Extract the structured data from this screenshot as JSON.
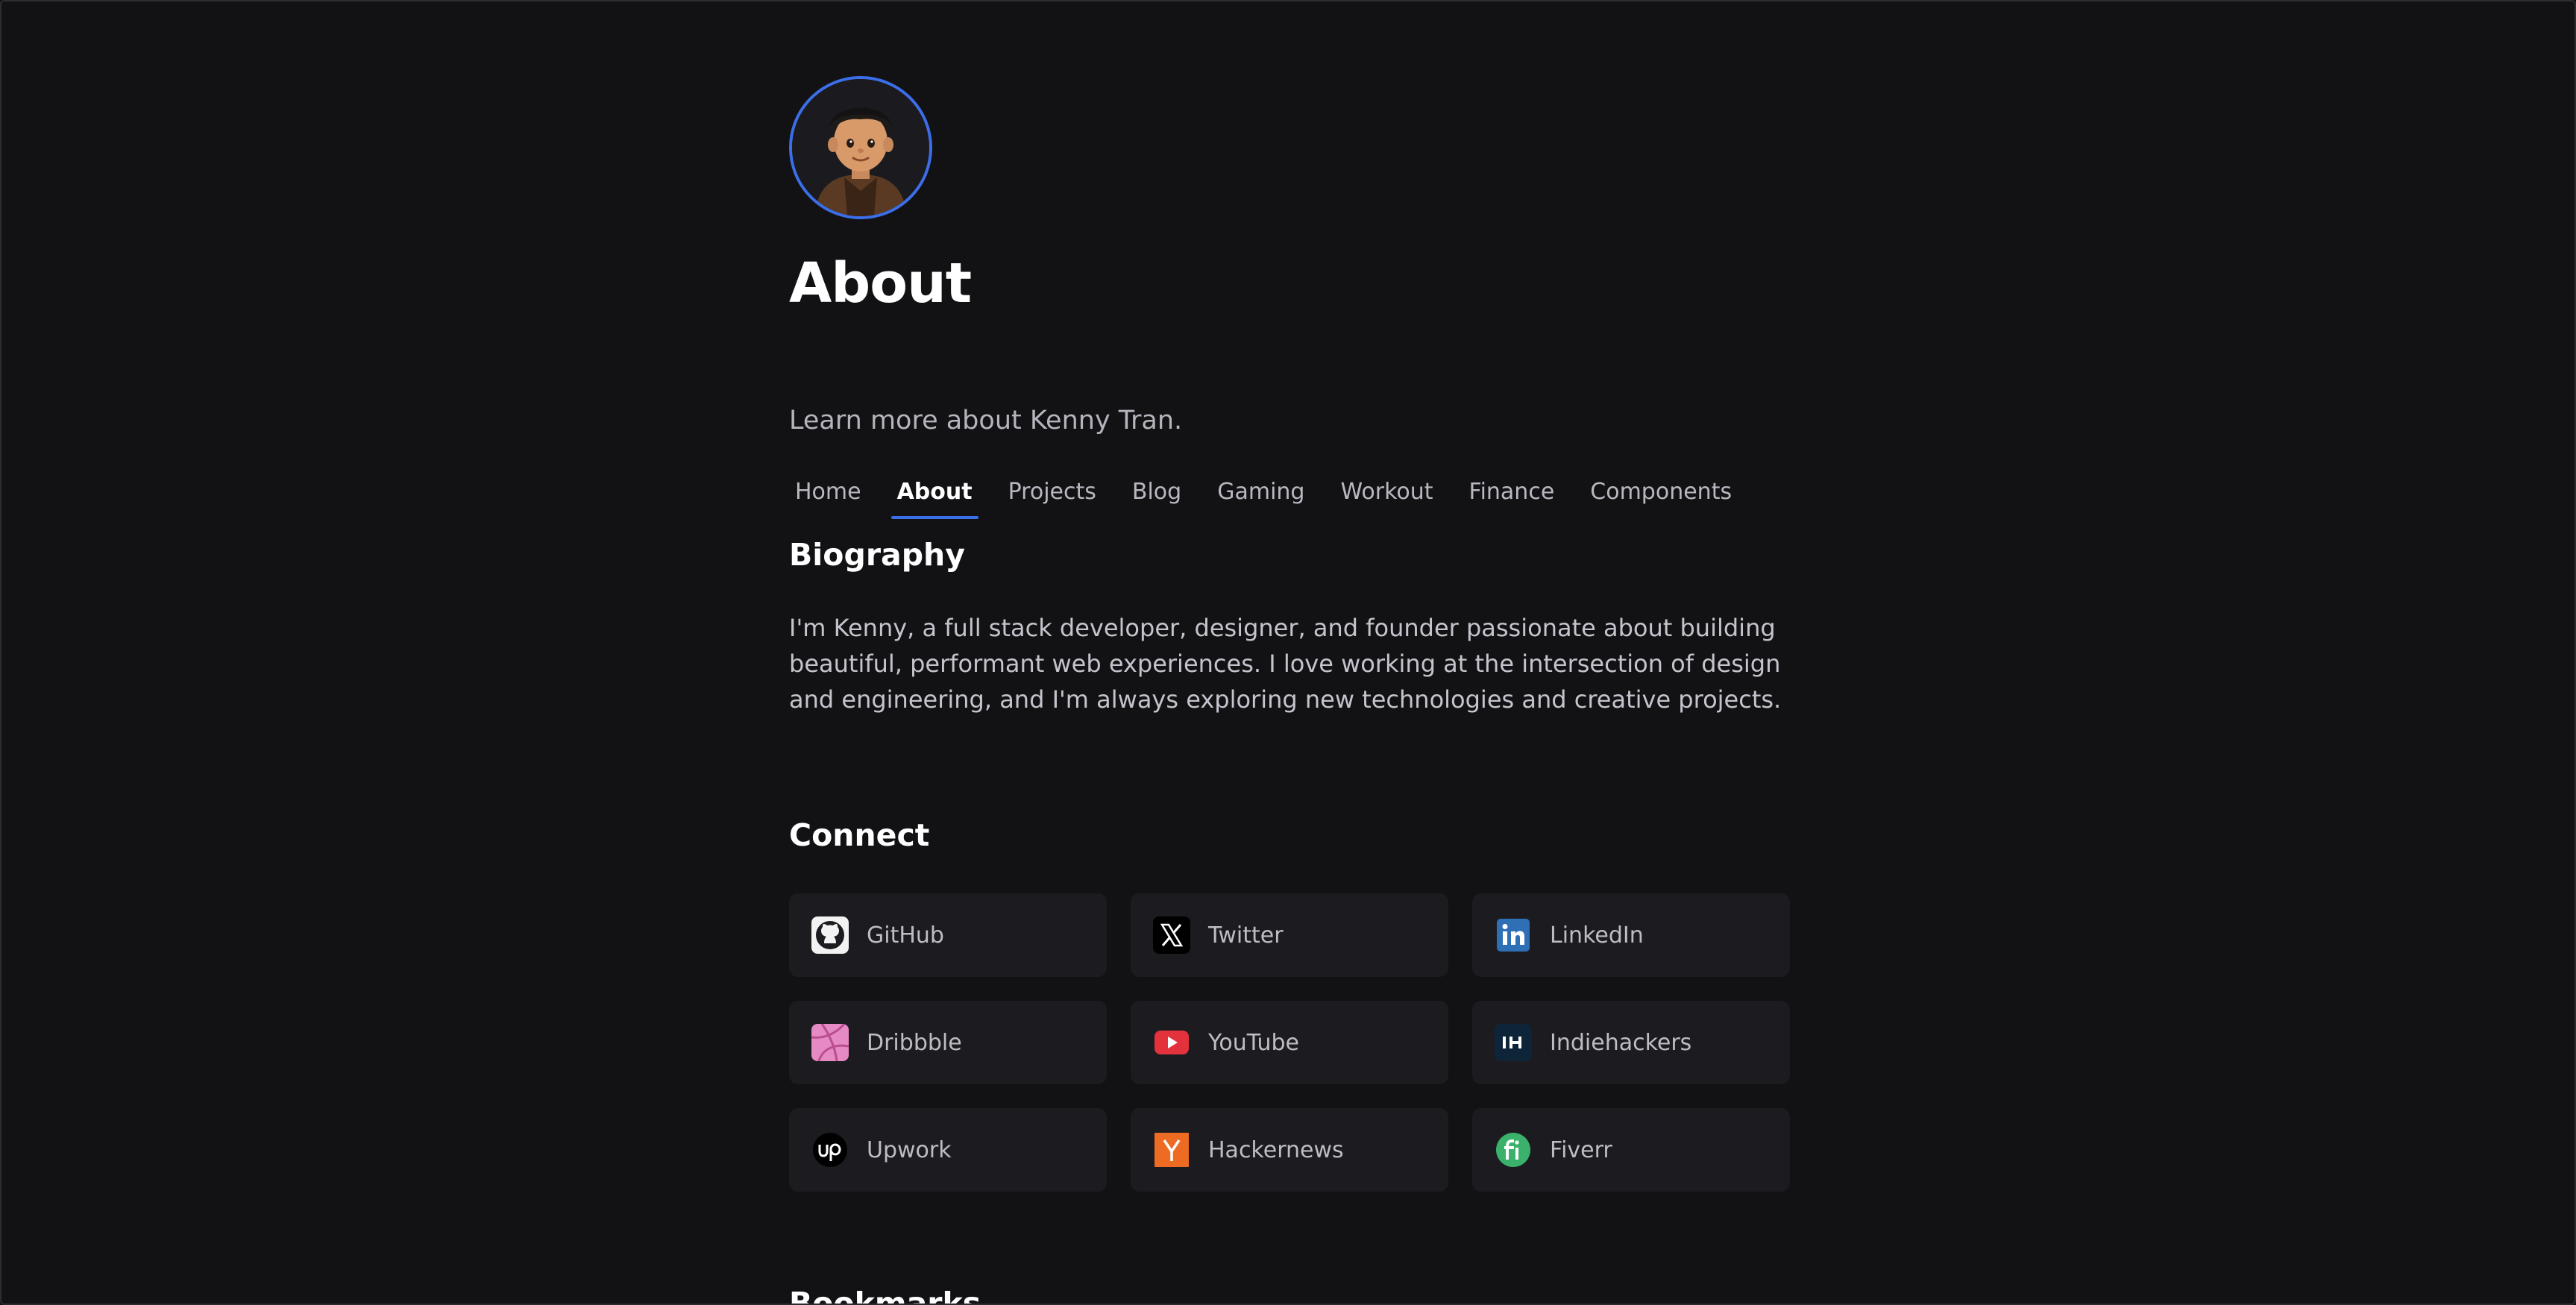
{
  "profile": {
    "avatar_icon": "avatar-portrait",
    "title": "About",
    "subtitle": "Learn more about Kenny Tran.",
    "accent": "#3b6ee8"
  },
  "nav": {
    "items": [
      {
        "label": "Home",
        "active": false
      },
      {
        "label": "About",
        "active": true
      },
      {
        "label": "Projects",
        "active": false
      },
      {
        "label": "Blog",
        "active": false
      },
      {
        "label": "Gaming",
        "active": false
      },
      {
        "label": "Workout",
        "active": false
      },
      {
        "label": "Finance",
        "active": false
      },
      {
        "label": "Components",
        "active": false
      }
    ]
  },
  "biography": {
    "heading": "Biography",
    "text": "I'm Kenny, a full stack developer, designer, and founder passionate about building beautiful, performant web experiences. I love working at the intersection of design and engineering, and I'm always exploring new technologies and creative projects."
  },
  "connect": {
    "heading": "Connect",
    "links": [
      {
        "label": "GitHub",
        "icon": "github-icon"
      },
      {
        "label": "Twitter",
        "icon": "x-icon"
      },
      {
        "label": "LinkedIn",
        "icon": "linkedin-icon"
      },
      {
        "label": "Dribbble",
        "icon": "dribbble-icon"
      },
      {
        "label": "YouTube",
        "icon": "youtube-icon"
      },
      {
        "label": "Indiehackers",
        "icon": "indiehackers-icon"
      },
      {
        "label": "Upwork",
        "icon": "upwork-icon"
      },
      {
        "label": "Hackernews",
        "icon": "hackernews-icon"
      },
      {
        "label": "Fiverr",
        "icon": "fiverr-icon"
      }
    ]
  },
  "bookmarks": {
    "heading": "Bookmarks"
  },
  "colors": {
    "background": "#121215",
    "card": "#1c1c20",
    "accent": "#3b6ee8"
  }
}
